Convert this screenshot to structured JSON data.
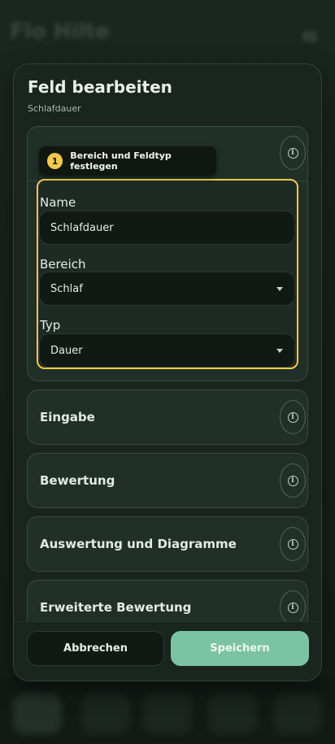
{
  "background": {
    "title": "Flo­ Hilte",
    "nav_items": [
      "home",
      "stats",
      "add",
      "history",
      "profile"
    ]
  },
  "dialog": {
    "title": "Feld bearbeiten",
    "subtitle": "Schlafdauer",
    "tooltip": {
      "step": "1",
      "text": "Bereich und Feldtyp festlegen"
    },
    "fields": {
      "name_label": "Name",
      "name_value": "Schlafdauer",
      "area_label": "Bereich",
      "area_value": "Schlaf",
      "type_label": "Typ",
      "type_value": "Dauer"
    },
    "sections": [
      {
        "title": "Eingabe"
      },
      {
        "title": "Bewertung"
      },
      {
        "title": "Auswertung und Diagramme"
      },
      {
        "title": "Erweiterte Bewertung"
      }
    ],
    "buttons": {
      "cancel": "Abbrechen",
      "save": "Speichern"
    }
  },
  "colors": {
    "accent": "#7cc3a4",
    "highlight": "#f2c94c",
    "surface": "#1a2520"
  },
  "icons": {
    "info": "info-icon",
    "dropdown": "chevron-down-icon"
  }
}
